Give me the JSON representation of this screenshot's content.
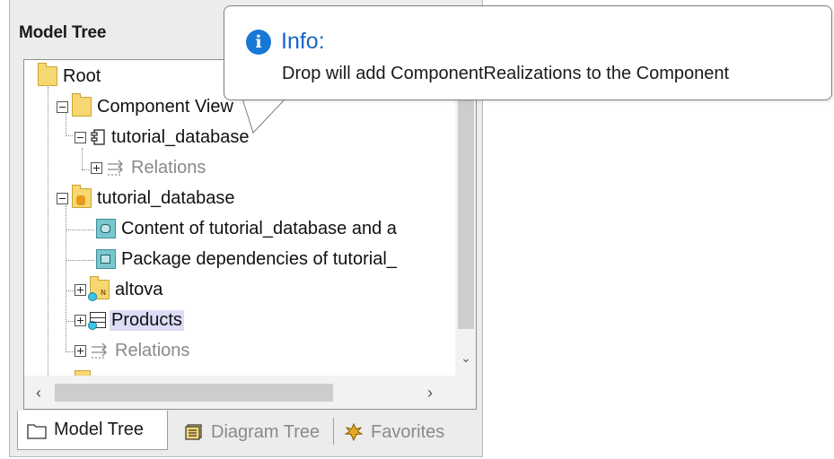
{
  "panel": {
    "title": "Model Tree"
  },
  "tree": {
    "root": "Root",
    "component_view": "Component View",
    "component": "tutorial_database",
    "component_relations": "Relations",
    "package": "tutorial_database",
    "diagram_content": "Content of tutorial_database and a",
    "diagram_package_deps": "Package dependencies of tutorial_",
    "ns_altova": "altova",
    "table_products": "Products",
    "package_relations": "Relations"
  },
  "tabs": [
    {
      "label": "Model Tree",
      "active": true
    },
    {
      "label": "Diagram Tree",
      "active": false
    },
    {
      "label": "Favorites",
      "active": false
    }
  ],
  "tooltip": {
    "icon": "info-icon",
    "title": "Info:",
    "message": "Drop will add ComponentRealizations to the Component"
  },
  "colors": {
    "tooltip_title": "#1865c6",
    "info_icon": "#1878d6",
    "selection": "#dcdcf6",
    "folder": "#f7d772",
    "teal_diagram": "#7ac6cf"
  }
}
